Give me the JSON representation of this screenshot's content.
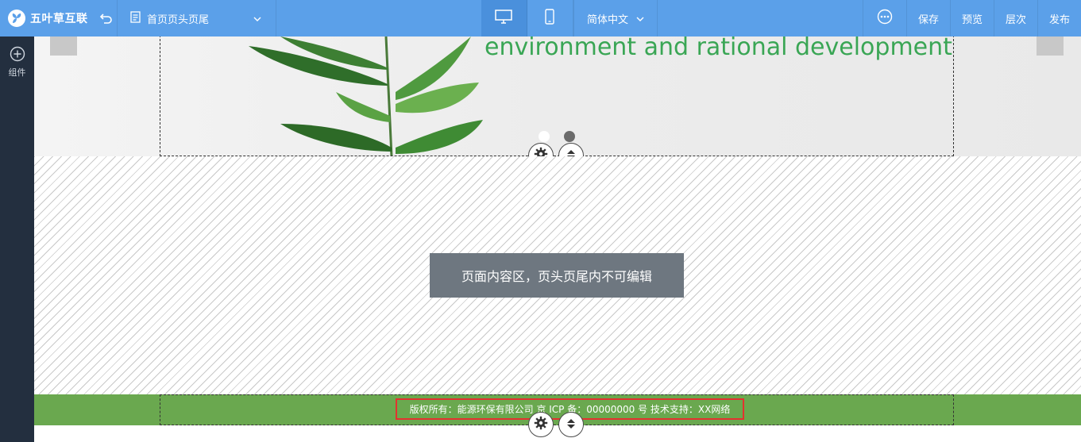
{
  "toolbar": {
    "brand": "五叶草互联",
    "page_name": "首页页头页尾",
    "language": "简体中文",
    "actions": [
      "保存",
      "预览",
      "层次",
      "发布"
    ]
  },
  "sidebar": {
    "components_label": "组件"
  },
  "banner": {
    "headline": "environment and rational development",
    "slides": 2,
    "active_slide": 2
  },
  "content": {
    "notice": "页面内容区，页头页尾内不可编辑"
  },
  "footer": {
    "text": "版权所有：能源环保有限公司  京 ICP 备：00000000 号  技术支持：XX网络"
  },
  "colors": {
    "toolbar": "#5ba0e9",
    "sidebar": "#232f3f",
    "footer": "#6aa84f",
    "headline": "#3aa655",
    "highlight": "#e2322f"
  }
}
